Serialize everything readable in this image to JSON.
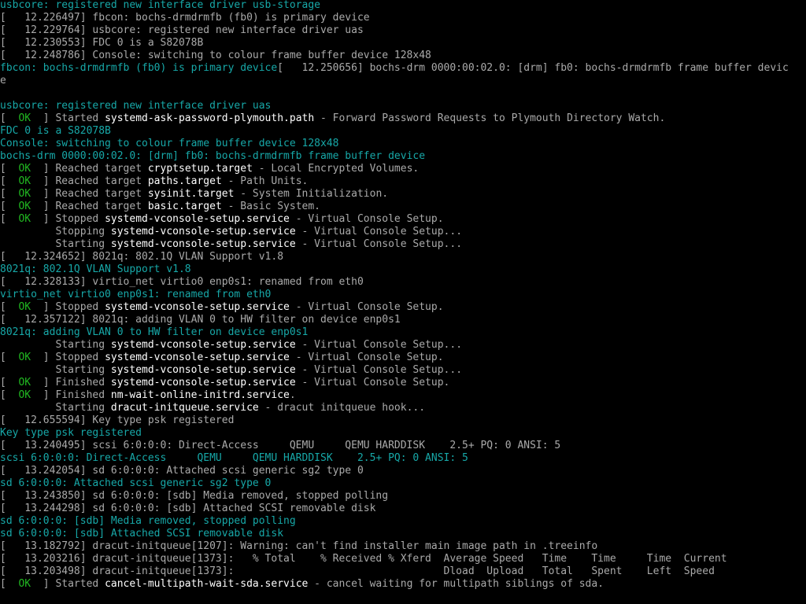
{
  "palette": {
    "background": "#000000",
    "gray": "#aaaaaa",
    "cyan": "#17a8a8",
    "green": "#21b921",
    "white": "#ffffff"
  },
  "lines": [
    [
      {
        "c": "cyan",
        "t": "usbcore: registered new interface driver usb-storage"
      }
    ],
    [
      {
        "c": "gray",
        "t": "[   12.226497] fbcon: bochs-drmdrmfb (fb0) is primary device"
      }
    ],
    [
      {
        "c": "gray",
        "t": "[   12.229764] usbcore: registered new interface driver uas"
      }
    ],
    [
      {
        "c": "gray",
        "t": "[   12.230553] FDC 0 is a S82078B"
      }
    ],
    [
      {
        "c": "gray",
        "t": "[   12.248786] Console: switching to colour frame buffer device 128x48"
      }
    ],
    [
      {
        "c": "cyan",
        "t": "fbcon: bochs-drmdrmfb (fb0) is primary device"
      },
      {
        "c": "gray",
        "t": "[   12.250656] bochs-drm 0000:00:02.0: [drm] fb0: bochs-drmdrmfb frame buffer devic"
      }
    ],
    [
      {
        "c": "gray",
        "t": "e"
      }
    ],
    [],
    [
      {
        "c": "cyan",
        "t": "usbcore: registered new interface driver uas"
      }
    ],
    [
      {
        "c": "gray",
        "t": "[  "
      },
      {
        "c": "green",
        "t": "OK"
      },
      {
        "c": "gray",
        "t": "  ] Started "
      },
      {
        "c": "white",
        "t": "systemd-ask-password-plymouth.path"
      },
      {
        "c": "gray",
        "t": " - Forward Password Requests to Plymouth Directory Watch."
      }
    ],
    [
      {
        "c": "cyan",
        "t": "FDC 0 is a S82078B"
      }
    ],
    [
      {
        "c": "cyan",
        "t": "Console: switching to colour frame buffer device 128x48"
      }
    ],
    [
      {
        "c": "cyan",
        "t": "bochs-drm 0000:00:02.0: [drm] fb0: bochs-drmdrmfb frame buffer device"
      }
    ],
    [
      {
        "c": "gray",
        "t": "[  "
      },
      {
        "c": "green",
        "t": "OK"
      },
      {
        "c": "gray",
        "t": "  ] Reached target "
      },
      {
        "c": "white",
        "t": "cryptsetup.target"
      },
      {
        "c": "gray",
        "t": " - Local Encrypted Volumes."
      }
    ],
    [
      {
        "c": "gray",
        "t": "[  "
      },
      {
        "c": "green",
        "t": "OK"
      },
      {
        "c": "gray",
        "t": "  ] Reached target "
      },
      {
        "c": "white",
        "t": "paths.target"
      },
      {
        "c": "gray",
        "t": " - Path Units."
      }
    ],
    [
      {
        "c": "gray",
        "t": "[  "
      },
      {
        "c": "green",
        "t": "OK"
      },
      {
        "c": "gray",
        "t": "  ] Reached target "
      },
      {
        "c": "white",
        "t": "sysinit.target"
      },
      {
        "c": "gray",
        "t": " - System Initialization."
      }
    ],
    [
      {
        "c": "gray",
        "t": "[  "
      },
      {
        "c": "green",
        "t": "OK"
      },
      {
        "c": "gray",
        "t": "  ] Reached target "
      },
      {
        "c": "white",
        "t": "basic.target"
      },
      {
        "c": "gray",
        "t": " - Basic System."
      }
    ],
    [
      {
        "c": "gray",
        "t": "[  "
      },
      {
        "c": "green",
        "t": "OK"
      },
      {
        "c": "gray",
        "t": "  ] Stopped "
      },
      {
        "c": "white",
        "t": "systemd-vconsole-setup.service"
      },
      {
        "c": "gray",
        "t": " - Virtual Console Setup."
      }
    ],
    [
      {
        "c": "gray",
        "t": "         Stopping "
      },
      {
        "c": "white",
        "t": "systemd-vconsole-setup.service"
      },
      {
        "c": "gray",
        "t": " - Virtual Console Setup..."
      }
    ],
    [
      {
        "c": "gray",
        "t": "         Starting "
      },
      {
        "c": "white",
        "t": "systemd-vconsole-setup.service"
      },
      {
        "c": "gray",
        "t": " - Virtual Console Setup..."
      }
    ],
    [
      {
        "c": "gray",
        "t": "[   12.324652] 8021q: 802.1Q VLAN Support v1.8"
      }
    ],
    [
      {
        "c": "cyan",
        "t": "8021q: 802.1Q VLAN Support v1.8"
      }
    ],
    [
      {
        "c": "gray",
        "t": "[   12.328133] virtio_net virtio0 enp0s1: renamed from eth0"
      }
    ],
    [
      {
        "c": "cyan",
        "t": "virtio_net virtio0 enp0s1: renamed from eth0"
      }
    ],
    [
      {
        "c": "gray",
        "t": "[  "
      },
      {
        "c": "green",
        "t": "OK"
      },
      {
        "c": "gray",
        "t": "  ] Stopped "
      },
      {
        "c": "white",
        "t": "systemd-vconsole-setup.service"
      },
      {
        "c": "gray",
        "t": " - Virtual Console Setup."
      }
    ],
    [
      {
        "c": "gray",
        "t": "[   12.357122] 8021q: adding VLAN 0 to HW filter on device enp0s1"
      }
    ],
    [
      {
        "c": "cyan",
        "t": "8021q: adding VLAN 0 to HW filter on device enp0s1"
      }
    ],
    [
      {
        "c": "gray",
        "t": "         Starting "
      },
      {
        "c": "white",
        "t": "systemd-vconsole-setup.service"
      },
      {
        "c": "gray",
        "t": " - Virtual Console Setup..."
      }
    ],
    [
      {
        "c": "gray",
        "t": "[  "
      },
      {
        "c": "green",
        "t": "OK"
      },
      {
        "c": "gray",
        "t": "  ] Stopped "
      },
      {
        "c": "white",
        "t": "systemd-vconsole-setup.service"
      },
      {
        "c": "gray",
        "t": " - Virtual Console Setup."
      }
    ],
    [
      {
        "c": "gray",
        "t": "         Starting "
      },
      {
        "c": "white",
        "t": "systemd-vconsole-setup.service"
      },
      {
        "c": "gray",
        "t": " - Virtual Console Setup..."
      }
    ],
    [
      {
        "c": "gray",
        "t": "[  "
      },
      {
        "c": "green",
        "t": "OK"
      },
      {
        "c": "gray",
        "t": "  ] Finished "
      },
      {
        "c": "white",
        "t": "systemd-vconsole-setup.service"
      },
      {
        "c": "gray",
        "t": " - Virtual Console Setup."
      }
    ],
    [
      {
        "c": "gray",
        "t": "[  "
      },
      {
        "c": "green",
        "t": "OK"
      },
      {
        "c": "gray",
        "t": "  ] Finished "
      },
      {
        "c": "white",
        "t": "nm-wait-online-initrd.service"
      },
      {
        "c": "gray",
        "t": "."
      }
    ],
    [
      {
        "c": "gray",
        "t": "         Starting "
      },
      {
        "c": "white",
        "t": "dracut-initqueue.service"
      },
      {
        "c": "gray",
        "t": " - dracut initqueue hook..."
      }
    ],
    [
      {
        "c": "gray",
        "t": "[   12.655594] Key type psk registered"
      }
    ],
    [
      {
        "c": "cyan",
        "t": "Key type psk registered"
      }
    ],
    [
      {
        "c": "gray",
        "t": "[   13.240495] scsi 6:0:0:0: Direct-Access     QEMU     QEMU HARDDISK    2.5+ PQ: 0 ANSI: 5"
      }
    ],
    [
      {
        "c": "cyan",
        "t": "scsi 6:0:0:0: Direct-Access     QEMU     QEMU HARDDISK    2.5+ PQ: 0 ANSI: 5"
      }
    ],
    [
      {
        "c": "gray",
        "t": "[   13.242054] sd 6:0:0:0: Attached scsi generic sg2 type 0"
      }
    ],
    [
      {
        "c": "cyan",
        "t": "sd 6:0:0:0: Attached scsi generic sg2 type 0"
      }
    ],
    [
      {
        "c": "gray",
        "t": "[   13.243850] sd 6:0:0:0: [sdb] Media removed, stopped polling"
      }
    ],
    [
      {
        "c": "gray",
        "t": "[   13.244298] sd 6:0:0:0: [sdb] Attached SCSI removable disk"
      }
    ],
    [
      {
        "c": "cyan",
        "t": "sd 6:0:0:0: [sdb] Media removed, stopped polling"
      }
    ],
    [
      {
        "c": "cyan",
        "t": "sd 6:0:0:0: [sdb] Attached SCSI removable disk"
      }
    ],
    [
      {
        "c": "gray",
        "t": "[   13.182792] dracut-initqueue[1207]: Warning: can't find installer main image path in .treeinfo"
      }
    ],
    [
      {
        "c": "gray",
        "t": "[   13.203216] dracut-initqueue[1373]:   % Total    % Received % Xferd  Average Speed   Time    Time     Time  Current"
      }
    ],
    [
      {
        "c": "gray",
        "t": "[   13.203498] dracut-initqueue[1373]:                                  Dload  Upload   Total   Spent    Left  Speed"
      }
    ],
    [
      {
        "c": "gray",
        "t": "[  "
      },
      {
        "c": "green",
        "t": "OK"
      },
      {
        "c": "gray",
        "t": "  ] Started "
      },
      {
        "c": "white",
        "t": "cancel-multipath-wait-sda.service"
      },
      {
        "c": "gray",
        "t": " - cancel waiting for multipath siblings of sda."
      }
    ]
  ]
}
